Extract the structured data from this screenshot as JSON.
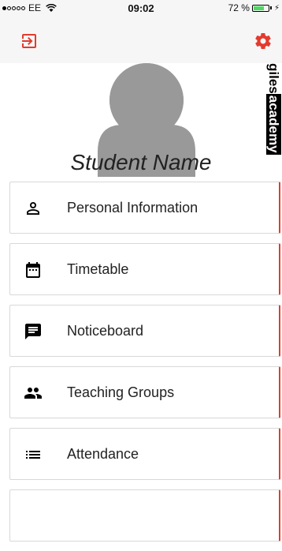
{
  "status_bar": {
    "carrier": "EE",
    "time": "09:02",
    "battery": "72 %",
    "battery_level": 0.72
  },
  "colors": {
    "accent": "#e33b2e",
    "avatar": "#999999",
    "battery": "#4cd964"
  },
  "header": {
    "logout_icon": "logout-icon",
    "settings_icon": "gear-icon"
  },
  "profile": {
    "student_name": "Student Name",
    "brand_part1": "giles",
    "brand_part2": "academy"
  },
  "menu": {
    "items": [
      {
        "label": "Personal Information",
        "icon": "person-icon"
      },
      {
        "label": "Timetable",
        "icon": "calendar-icon"
      },
      {
        "label": "Noticeboard",
        "icon": "message-icon"
      },
      {
        "label": "Teaching Groups",
        "icon": "group-icon"
      },
      {
        "label": "Attendance",
        "icon": "list-icon"
      }
    ]
  }
}
